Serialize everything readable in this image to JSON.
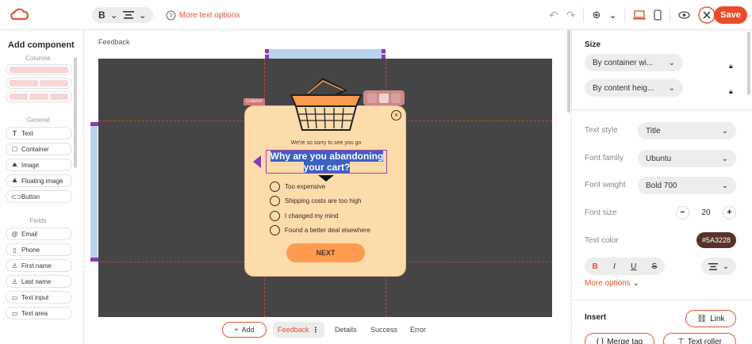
{
  "toolbar": {
    "bold_label": "B",
    "more_text_options": "More text options",
    "save_label": "Save"
  },
  "left_panel": {
    "title": "Add component",
    "columns_label": "Columns",
    "general_label": "General",
    "general_items": [
      "Text",
      "Container",
      "Image",
      "Floating image",
      "Button"
    ],
    "fields_label": "Fields",
    "field_items": [
      "Email",
      "Phone",
      "First name",
      "Last name",
      "Text input",
      "Text area"
    ]
  },
  "canvas": {
    "breadcrumb": "Feedback",
    "column_tag": "Column",
    "popup": {
      "subtitle": "We're so sorry to see you go",
      "headline_line1": "Why are you abandoning",
      "headline_line2": "your cart?",
      "options": [
        "Too expensive",
        "Shipping costs are too high",
        "I changed my mind",
        "Found a better deal elsewhere"
      ],
      "next_label": "NEXT"
    }
  },
  "bottom_tabs": {
    "add_label": "Add",
    "tabs": [
      "Feedback",
      "Details",
      "Success",
      "Error"
    ]
  },
  "right_panel": {
    "size_title": "Size",
    "width_mode": "By container wi...",
    "height_mode": "By content heig...",
    "text_style_label": "Text style",
    "text_style_value": "Title",
    "font_family_label": "Font family",
    "font_family_value": "Ubuntu",
    "font_weight_label": "Font weight",
    "font_weight_value": "Bold 700",
    "font_size_label": "Font size",
    "font_size_value": "20",
    "text_color_label": "Text color",
    "text_color_value": "#5A3228",
    "more_options": "More options",
    "insert_title": "Insert",
    "link_label": "Link",
    "merge_tag_label": "Merge tag",
    "text_roller_label": "Text roller"
  },
  "colors": {
    "accent": "#e0532e",
    "popup_bg": "#fddcab",
    "button_bg": "#ff9b4f",
    "text_color": "#5a3228",
    "canvas_bg": "#454545"
  }
}
